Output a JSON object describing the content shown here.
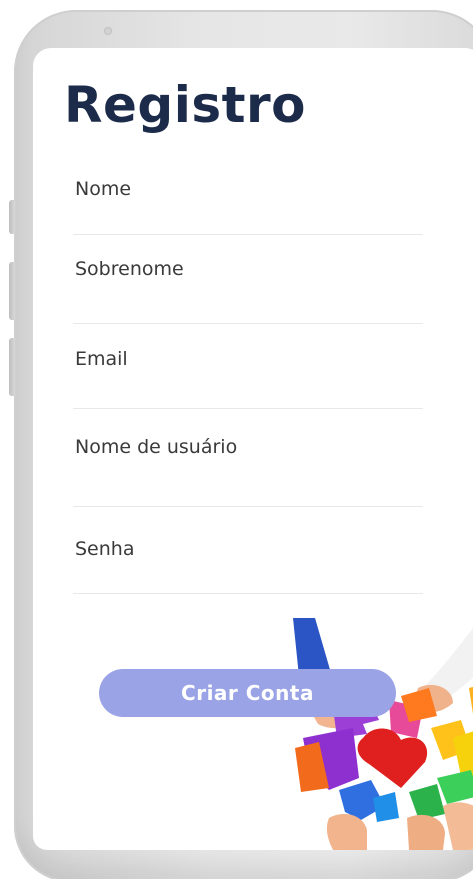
{
  "screen": {
    "title": "Registro"
  },
  "form": {
    "fields": [
      {
        "name": "nome",
        "placeholder": "Nome",
        "value": ""
      },
      {
        "name": "sobrenome",
        "placeholder": "Sobrenome",
        "value": ""
      },
      {
        "name": "email",
        "placeholder": "Email",
        "value": ""
      },
      {
        "name": "usuario",
        "placeholder": "Nome de usuário",
        "value": ""
      },
      {
        "name": "senha",
        "placeholder": "Senha",
        "value": ""
      }
    ],
    "submit_label": "Criar Conta"
  },
  "colors": {
    "title": "#1c2b4a",
    "button": "#99a3e6",
    "button_text": "#ffffff",
    "divider": "#e8e8e8"
  },
  "decoration": {
    "illustration": "hands-holding-puzzle-pieces-icon"
  }
}
